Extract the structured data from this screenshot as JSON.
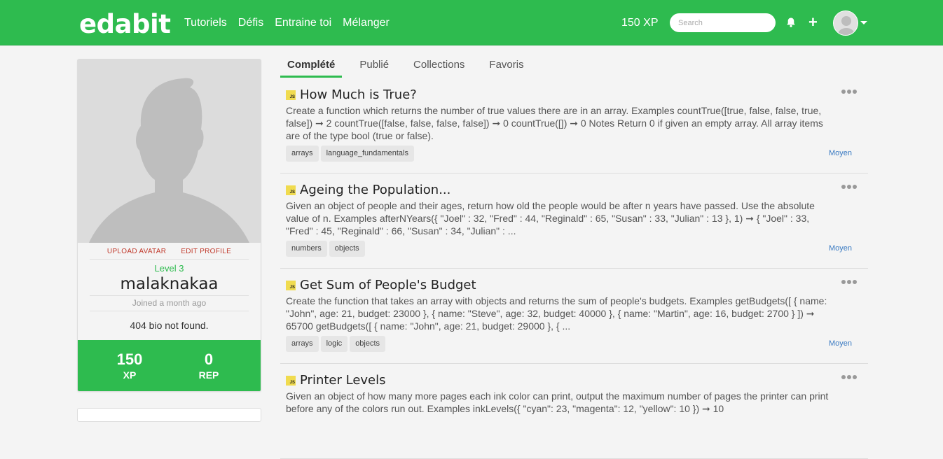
{
  "header": {
    "logo": "edabit",
    "nav": [
      "Tutoriels",
      "Défis",
      "Entraine toi",
      "Mélanger"
    ],
    "xp": "150 XP",
    "search_placeholder": "Search",
    "icons": [
      "bell-icon",
      "plus-icon",
      "avatar",
      "caret-down-icon"
    ],
    "brand_color": "#2ebb4f"
  },
  "profile": {
    "upload_avatar": "UPLOAD AVATAR",
    "edit_profile": "EDIT PROFILE",
    "level": "Level 3",
    "username": "malaknakaa",
    "joined": "Joined a month ago",
    "bio": "404 bio not found.",
    "xp_value": "150",
    "xp_label": "XP",
    "rep_value": "0",
    "rep_label": "REP"
  },
  "tabs": [
    {
      "label": "Complété",
      "active": true
    },
    {
      "label": "Publié",
      "active": false
    },
    {
      "label": "Collections",
      "active": false
    },
    {
      "label": "Favoris",
      "active": false
    }
  ],
  "challenges": [
    {
      "language": "JS",
      "title": "How Much is True?",
      "description": "Create a function which returns the number of true values there are in an array. Examples countTrue([true, false, false, true, false]) ➞ 2 countTrue([false, false, false, false]) ➞ 0 countTrue([]) ➞ 0 Notes Return 0 if given an empty array. All array items are of the type bool (true or false).",
      "tags": [
        "arrays",
        "language_fundamentals"
      ],
      "difficulty": "Moyen"
    },
    {
      "language": "JS",
      "title": "Ageing the Population...",
      "description": "Given an object of people and their ages, return how old the people would be after n years have passed. Use the absolute value of n. Examples afterNYears({ \"Joel\" : 32, \"Fred\" : 44, \"Reginald\" : 65, \"Susan\" : 33, \"Julian\" : 13 }, 1) ➞ { \"Joel\" : 33, \"Fred\" : 45, \"Reginald\" : 66, \"Susan\" : 34, \"Julian\" : ...",
      "tags": [
        "numbers",
        "objects"
      ],
      "difficulty": "Moyen"
    },
    {
      "language": "JS",
      "title": "Get Sum of People's Budget",
      "description": "Create the function that takes an array with objects and returns the sum of people's budgets. Examples getBudgets([ { name: \"John\", age: 21, budget: 23000 }, { name: \"Steve\", age: 32, budget: 40000 }, { name: \"Martin\", age: 16, budget: 2700 } ]) ➞ 65700 getBudgets([ { name: \"John\", age: 21, budget: 29000 }, { ...",
      "tags": [
        "arrays",
        "logic",
        "objects"
      ],
      "difficulty": "Moyen"
    },
    {
      "language": "JS",
      "title": "Printer Levels",
      "description": "Given an object of how many more pages each ink color can print, output the maximum number of pages the printer can print before any of the colors run out. Examples inkLevels({ \"cyan\": 23, \"magenta\": 12, \"yellow\": 10 }) ➞ 10",
      "tags": [],
      "difficulty": ""
    }
  ]
}
